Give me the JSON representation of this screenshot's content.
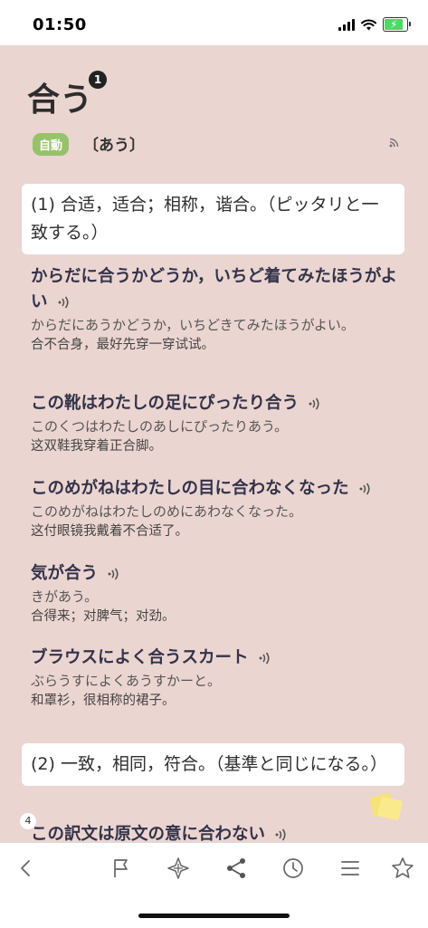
{
  "status": {
    "time": "01:50"
  },
  "entry": {
    "headword": "合う",
    "headword_badge": "1",
    "pos": "自動",
    "reading": "〔あう〕"
  },
  "senses": [
    {
      "text": "(1) 合适，适合；相称，谐合。（ピッタリと一致する。）"
    },
    {
      "text": "(2) 一致，相同，符合。（基準と同じになる。）"
    }
  ],
  "examples": [
    {
      "jp": "からだに合うかどうか，いちど着てみたほうがよい",
      "kana": "からだにあうかどうか，いちどきてみたほうがよい。",
      "cn": "合不合身，最好先穿一穿试试。"
    },
    {
      "jp": "この靴はわたしの足にぴったり合う",
      "kana": "このくつはわたしのあしにぴったりあう。",
      "cn": "这双鞋我穿着正合脚。"
    },
    {
      "jp": "このめがねはわたしの目に合わなくなった",
      "kana": "このめがねはわたしのめにあわなくなった。",
      "cn": "这付眼镜我戴着不合适了。"
    },
    {
      "jp": "気が合う",
      "kana": "きがあう。",
      "cn": "合得来；对脾气；对劲。"
    },
    {
      "jp": "ブラウスによく合うスカート",
      "kana": "ぶらうすによくあうすかーと。",
      "cn": "和罩衫，很相称的裙子。"
    },
    {
      "jp": "この訳文は原文の意に合わない"
    }
  ],
  "side_number": "4",
  "toolbar": {
    "icons": [
      "back-icon",
      "flag-icon",
      "compass-icon",
      "share-icon",
      "history-icon",
      "list-icon",
      "star-icon"
    ]
  }
}
